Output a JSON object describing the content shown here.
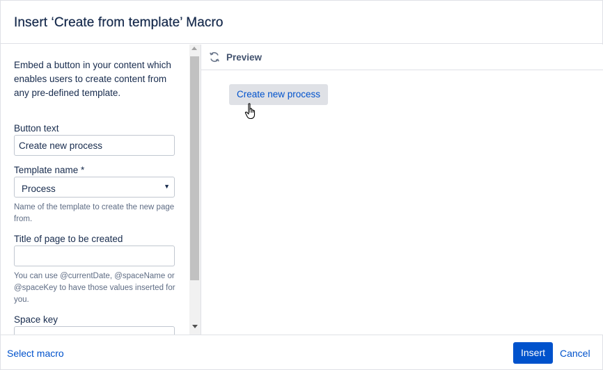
{
  "dialog": {
    "title": "Insert ‘Create from template’ Macro"
  },
  "form": {
    "description": "Embed a button in your content which enables users to create content from any pre-defined template.",
    "button_text_label": "Button text",
    "button_text_value": "Create new process",
    "template_name_label": "Template name *",
    "template_name_value": "Process",
    "template_name_help": "Name of the template to create the new page from.",
    "page_title_label": "Title of page to be created",
    "page_title_value": "",
    "page_title_help": "You can use @currentDate, @spaceName or @spaceKey to have those values inserted for you.",
    "space_key_label": "Space key",
    "space_key_value": ""
  },
  "preview": {
    "title": "Preview",
    "button_label": "Create new process",
    "refresh_icon": "refresh-icon",
    "cursor_icon": "hand-pointer-icon"
  },
  "footer": {
    "select_macro": "Select macro",
    "insert": "Insert",
    "cancel": "Cancel"
  },
  "colors": {
    "primary": "#0052cc",
    "text": "#172b4d",
    "subtle": "#5e6c84",
    "border": "#dfe1e6"
  }
}
